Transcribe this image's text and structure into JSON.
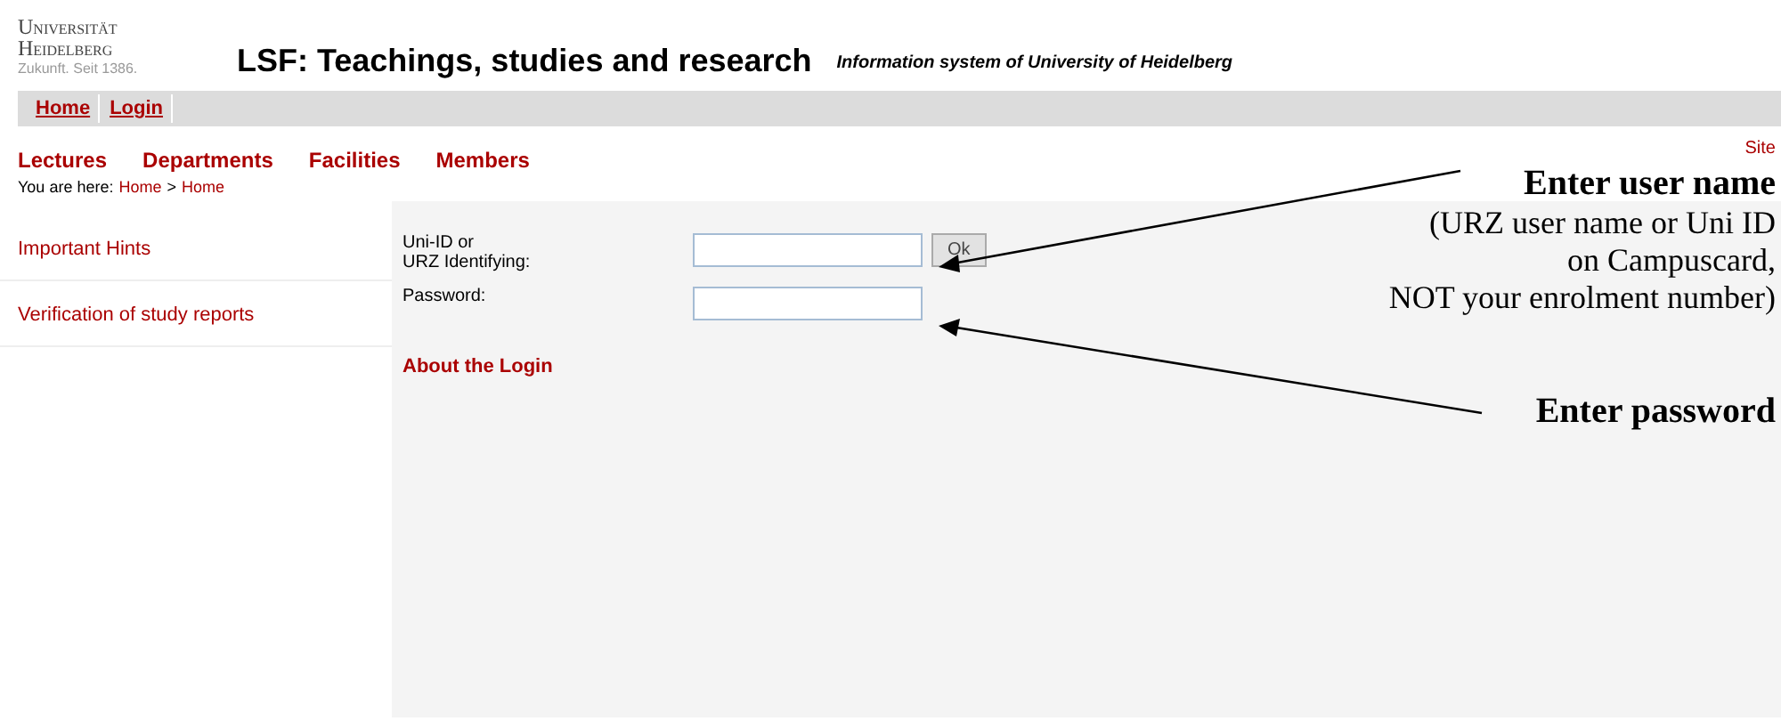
{
  "logo": {
    "lines": [
      "Universität",
      "Heidelberg"
    ],
    "tagline": "Zukunft. Seit 1386."
  },
  "header": {
    "title": "LSF: Teachings, studies and research",
    "subtitle": "Information system of University of Heidelberg"
  },
  "top_bar": [
    {
      "label": "Home",
      "selected": false
    },
    {
      "label": "Login",
      "selected": false
    }
  ],
  "nav": [
    "Lectures",
    "Departments",
    "Facilities",
    "Members"
  ],
  "breadcrumb": {
    "prefix": "You are here:",
    "items": [
      "Home",
      "Home"
    ],
    "separator": ">"
  },
  "site_link": "Site",
  "sidebar": [
    "Important Hints",
    "Verification of study reports"
  ],
  "login": {
    "fields": [
      {
        "label": "Uni-ID or\nURZ Identifying:"
      },
      {
        "label": "Password:"
      }
    ],
    "button": "Ok",
    "about": "About the Login"
  },
  "annotations": [
    {
      "title": "Enter user name",
      "lines": [
        "(URZ user name or Uni ID",
        "on Campuscard,",
        "NOT your enrolment number)"
      ]
    },
    {
      "title": "Enter password"
    }
  ]
}
